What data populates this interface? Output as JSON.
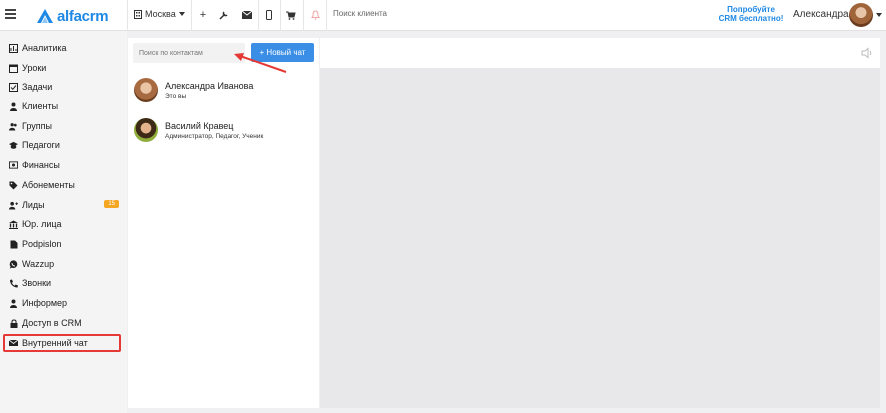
{
  "header": {
    "brand": "alfacrm",
    "city": "Москва",
    "client_search_placeholder": "Поиск клиента",
    "trial_line1": "Попробуйте",
    "trial_line2": "CRM бесплатно!",
    "user_name": "Александра"
  },
  "sidebar": {
    "items": [
      {
        "label": "Аналитика",
        "icon": "chart-icon"
      },
      {
        "label": "Уроки",
        "icon": "calendar-icon"
      },
      {
        "label": "Задачи",
        "icon": "tasks-icon"
      },
      {
        "label": "Клиенты",
        "icon": "user-icon"
      },
      {
        "label": "Группы",
        "icon": "group-icon"
      },
      {
        "label": "Педагоги",
        "icon": "graduation-cap-icon"
      },
      {
        "label": "Финансы",
        "icon": "money-icon"
      },
      {
        "label": "Абонементы",
        "icon": "tag-icon"
      },
      {
        "label": "Лиды",
        "icon": "user-plus-icon",
        "badge": "15"
      },
      {
        "label": "Юр. лица",
        "icon": "bank-icon"
      },
      {
        "label": "Podpislon",
        "icon": "document-icon"
      },
      {
        "label": "Wazzup",
        "icon": "whatsapp-icon"
      },
      {
        "label": "Звонки",
        "icon": "phone-icon"
      },
      {
        "label": "Информер",
        "icon": "user-icon"
      },
      {
        "label": "Доступ в CRM",
        "icon": "lock-icon"
      },
      {
        "label": "Внутренний чат",
        "icon": "chat-icon",
        "active": true
      }
    ]
  },
  "chat": {
    "search_placeholder": "Поиск по контактам",
    "new_chat_label": "+ Новый чат",
    "contacts": [
      {
        "name": "Александра Иванова",
        "role": "Это вы"
      },
      {
        "name": "Василий Кравец",
        "role": "Администратор, Педагог, Ученик"
      }
    ]
  },
  "colors": {
    "accent": "#1e88e5",
    "button": "#3a8ee6",
    "badge": "#f5a623",
    "highlight": "#e53935"
  }
}
